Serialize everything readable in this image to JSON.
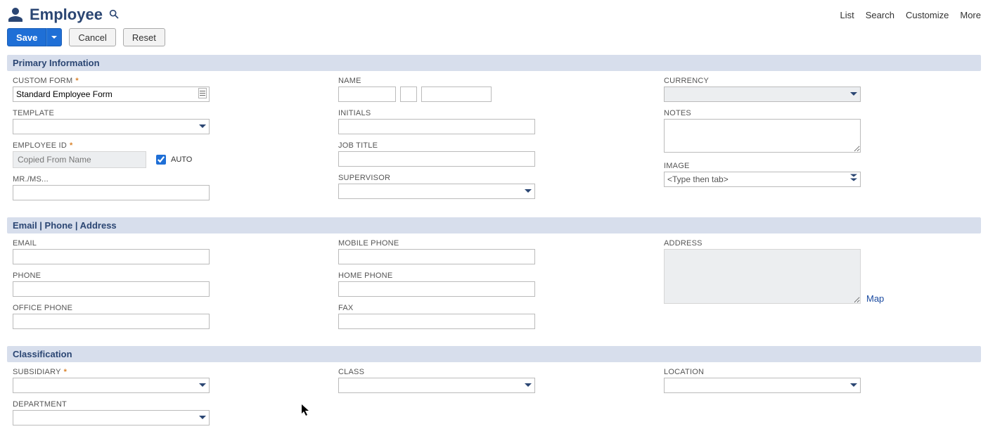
{
  "header": {
    "title": "Employee",
    "links": [
      "List",
      "Search",
      "Customize",
      "More"
    ]
  },
  "buttons": {
    "save": "Save",
    "cancel": "Cancel",
    "reset": "Reset"
  },
  "sections": {
    "primary": "Primary Information",
    "contact": "Email | Phone | Address",
    "classification": "Classification"
  },
  "primary": {
    "custom_form_label": "CUSTOM FORM",
    "custom_form_value": "Standard Employee Form",
    "template_label": "TEMPLATE",
    "employee_id_label": "EMPLOYEE ID",
    "employee_id_placeholder": "Copied From Name",
    "auto_label": "AUTO",
    "salutation_label": "MR./MS...",
    "name_label": "NAME",
    "initials_label": "INITIALS",
    "job_title_label": "JOB TITLE",
    "supervisor_label": "SUPERVISOR",
    "currency_label": "CURRENCY",
    "notes_label": "NOTES",
    "image_label": "IMAGE",
    "image_placeholder": "<Type then tab>"
  },
  "contact": {
    "email_label": "EMAIL",
    "phone_label": "PHONE",
    "office_phone_label": "OFFICE PHONE",
    "mobile_phone_label": "MOBILE PHONE",
    "home_phone_label": "HOME PHONE",
    "fax_label": "FAX",
    "address_label": "ADDRESS",
    "map_link": "Map"
  },
  "classification": {
    "subsidiary_label": "SUBSIDIARY",
    "department_label": "DEPARTMENT",
    "class_label": "CLASS",
    "location_label": "LOCATION"
  }
}
